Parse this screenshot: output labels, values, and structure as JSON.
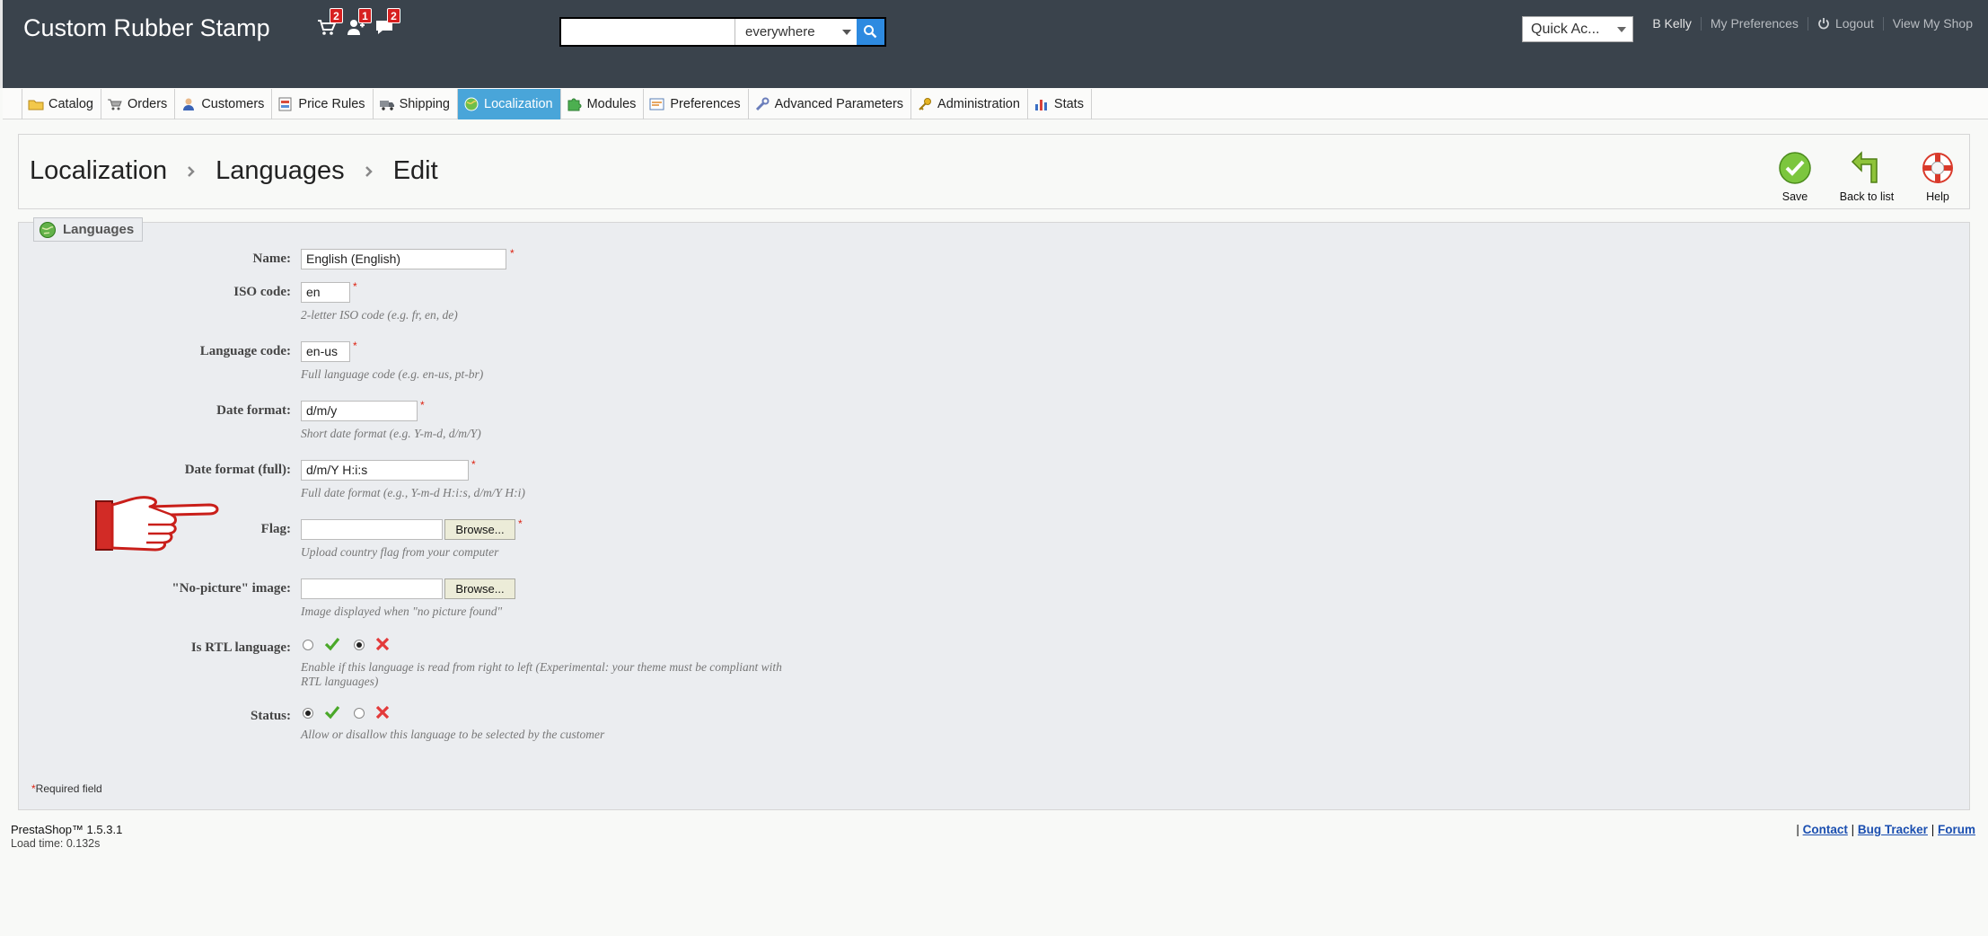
{
  "header": {
    "shop_name": "Custom Rubber Stamp",
    "notifications": [
      {
        "icon": "cart-icon",
        "count": "2"
      },
      {
        "icon": "customer-icon",
        "count": "1"
      },
      {
        "icon": "message-icon",
        "count": "2"
      }
    ],
    "search": {
      "value": "",
      "placeholder": "",
      "scope": "everywhere"
    },
    "quick_access": "Quick Ac...",
    "user": "B Kelly",
    "my_preferences": "My Preferences",
    "logout": "Logout",
    "view_shop": "View My Shop"
  },
  "menu": {
    "tabs": [
      {
        "label": "Catalog",
        "icon": "folder-icon"
      },
      {
        "label": "Orders",
        "icon": "cart-icon"
      },
      {
        "label": "Customers",
        "icon": "customer-icon"
      },
      {
        "label": "Price Rules",
        "icon": "price-tag-icon"
      },
      {
        "label": "Shipping",
        "icon": "truck-icon"
      },
      {
        "label": "Localization",
        "icon": "globe-icon",
        "active": true
      },
      {
        "label": "Modules",
        "icon": "puzzle-icon"
      },
      {
        "label": "Preferences",
        "icon": "preferences-icon"
      },
      {
        "label": "Advanced Parameters",
        "icon": "wrench-icon"
      },
      {
        "label": "Administration",
        "icon": "key-icon"
      },
      {
        "label": "Stats",
        "icon": "bar-chart-icon"
      }
    ]
  },
  "toolbar": {
    "breadcrumb": [
      "Localization",
      "Languages",
      "Edit"
    ],
    "save": "Save",
    "back": "Back to list",
    "help": "Help"
  },
  "form": {
    "legend": "Languages",
    "name_label": "Name:",
    "name_value": "English (English)",
    "iso_label": "ISO code:",
    "iso_value": "en",
    "iso_hint": "2-letter ISO code (e.g. fr, en, de)",
    "lang_label": "Language code:",
    "lang_value": "en-us",
    "lang_hint": "Full language code (e.g. en-us, pt-br)",
    "date_label": "Date format:",
    "date_value": "d/m/y",
    "date_hint": "Short date format (e.g. Y-m-d, d/m/Y)",
    "datefull_label": "Date format (full):",
    "datefull_value": "d/m/Y H:i:s",
    "datefull_hint": "Full date format (e.g., Y-m-d H:i:s, d/m/Y H:i)",
    "flag_label": "Flag:",
    "browse": "Browse...",
    "flag_hint": "Upload country flag from your computer",
    "nopic_label": "\"No-picture\" image:",
    "nopic_hint": "Image displayed when \"no picture found\"",
    "rtl_label": "Is RTL language:",
    "rtl_hint": "Enable if this language is read from right to left (Experimental: your theme must be compliant with RTL languages)",
    "status_label": "Status:",
    "status_hint": "Allow or disallow this language to be selected by the customer",
    "required_note": "Required field",
    "required_star": "*"
  },
  "footer": {
    "version": "PrestaShop™ 1.5.3.1",
    "load_time": "Load time: 0.132s",
    "contact": "Contact",
    "bug_tracker": "Bug Tracker",
    "forum": "Forum",
    "sep": "|"
  },
  "colors": {
    "header_bg": "#3a434c",
    "active_tab": "#49a5d9",
    "required": "#dd2211",
    "link": "#1b4fb0"
  }
}
